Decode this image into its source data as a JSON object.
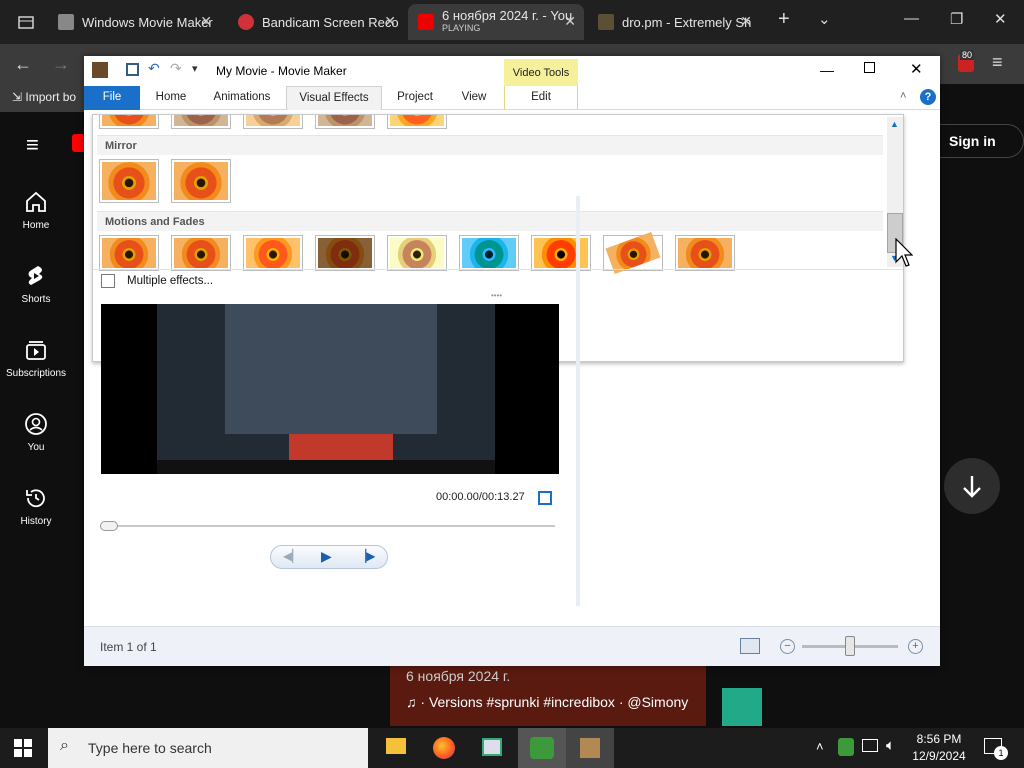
{
  "browser": {
    "tabs": [
      {
        "title": "Windows Movie Maker",
        "icon": "building-icon"
      },
      {
        "title": "Bandicam Screen Reco",
        "icon": "bandicam-icon"
      },
      {
        "title": "6 ноября 2024 г. - You",
        "subtitle": "PLAYING",
        "icon": "youtube-icon",
        "active": true
      },
      {
        "title": "dro.pm - Extremely Sh",
        "icon": "folder-icon"
      }
    ],
    "new_tab": "+",
    "bookmark": "Import bo",
    "badge": "80"
  },
  "youtube": {
    "nav": [
      {
        "label": "Home",
        "icon": "home-icon"
      },
      {
        "label": "Shorts",
        "icon": "shorts-icon"
      },
      {
        "label": "Subscriptions",
        "icon": "subscriptions-icon"
      },
      {
        "label": "You",
        "icon": "user-icon"
      },
      {
        "label": "History",
        "icon": "history-icon"
      }
    ],
    "sign_in": "Sign in",
    "caption_date": "6 ноября 2024 г.",
    "caption_tags": "· Versions #sprunki #incredibox · @Simony"
  },
  "moviemaker": {
    "title": "My Movie - Movie Maker",
    "video_tools": "Video Tools",
    "tabs": [
      "File",
      "Home",
      "Animations",
      "Visual Effects",
      "Project",
      "View",
      "Edit"
    ],
    "selected_tab": "Visual Effects",
    "gallery": {
      "sections": [
        "Mirror",
        "Motions and Fades"
      ],
      "multiple_effects": "Multiple effects..."
    },
    "player": {
      "time": "00:00.00/00:13.27",
      "progress": 0
    },
    "status": "Item 1 of 1",
    "zoom_level": 0.5
  },
  "taskbar": {
    "search_placeholder": "Type here to search",
    "time": "8:56 PM",
    "date": "12/9/2024",
    "notification_count": "1"
  }
}
